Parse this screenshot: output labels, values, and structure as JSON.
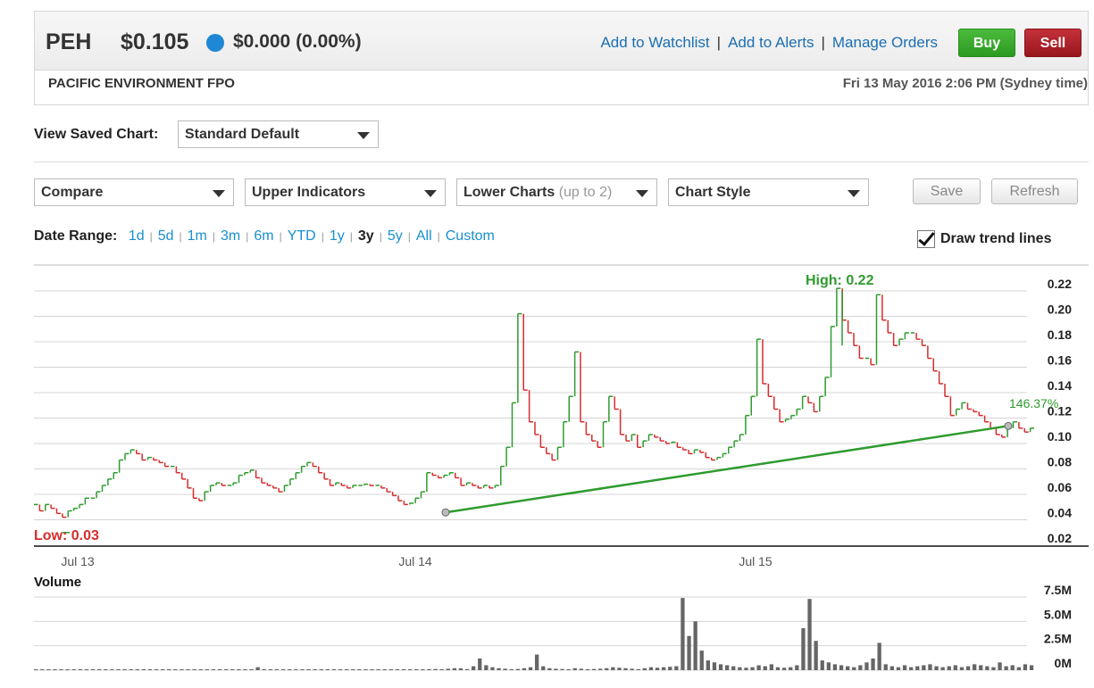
{
  "quote": {
    "ticker": "PEH",
    "price": "$0.105",
    "change": "$0.000 (0.00%)",
    "company": "PACIFIC ENVIRONMENT FPO",
    "datetime": "Fri 13 May 2016 2:06 PM (Sydney time)",
    "status_color": "#1e88d6"
  },
  "actions": {
    "watchlist": "Add to Watchlist",
    "alerts": "Add to Alerts",
    "orders": "Manage Orders",
    "buy": "Buy",
    "sell": "Sell"
  },
  "saved_chart": {
    "label": "View Saved Chart:",
    "value": "Standard Default"
  },
  "toolbar": {
    "compare": "Compare",
    "upper": "Upper Indicators",
    "lower": "Lower Charts",
    "lower_sub": "(up to 2)",
    "style": "Chart Style",
    "save": "Save",
    "refresh": "Refresh"
  },
  "date_range": {
    "label": "Date Range:",
    "options": [
      "1d",
      "5d",
      "1m",
      "3m",
      "6m",
      "YTD",
      "1y",
      "3y",
      "5y",
      "All",
      "Custom"
    ],
    "active": "3y"
  },
  "trend": {
    "label": "Draw trend lines",
    "checked": true
  },
  "chart_data": {
    "type": "line",
    "price_axis_ticks": [
      "0.22",
      "0.20",
      "0.18",
      "0.16",
      "0.14",
      "0.12",
      "0.10",
      "0.08",
      "0.06",
      "0.04",
      "0.02"
    ],
    "x_ticks": [
      "Jul 13",
      "Jul 14",
      "Jul 15"
    ],
    "high_label": "High: 0.22",
    "low_label": "Low: 0.03",
    "trendline_label": "146.37%",
    "volume_title": "Volume",
    "volume_ticks": [
      "7.5M",
      "5.0M",
      "2.5M",
      "0M"
    ],
    "ylim": [
      0.02,
      0.22
    ],
    "volume_max_millions": 7.5,
    "high": 0.22,
    "low": 0.03,
    "trendline": {
      "start": 0.043,
      "end": 0.111
    },
    "price_series": [
      [
        0.045,
        0.04,
        0.045,
        0.042
      ],
      [
        0.038,
        0.035,
        0.04,
        0.042
      ],
      [
        0.045,
        0.05,
        0.05,
        0.055
      ],
      [
        0.06,
        0.065,
        0.07,
        0.08
      ],
      [
        0.085,
        0.088,
        0.085,
        0.08
      ],
      [
        0.082,
        0.08,
        0.078,
        0.075
      ],
      [
        0.075,
        0.07,
        0.065,
        0.058
      ],
      [
        0.05,
        0.048,
        0.055,
        0.06
      ],
      [
        0.062,
        0.06,
        0.06,
        0.062
      ],
      [
        0.068,
        0.07,
        0.072,
        0.066
      ],
      [
        0.062,
        0.06,
        0.058,
        0.055
      ],
      [
        0.06,
        0.065,
        0.07,
        0.075
      ],
      [
        0.078,
        0.075,
        0.07,
        0.065
      ],
      [
        0.06,
        0.062,
        0.06,
        0.058
      ],
      [
        0.06,
        0.06,
        0.061,
        0.06
      ],
      [
        0.06,
        0.058,
        0.055,
        0.052
      ],
      [
        0.048,
        0.045,
        0.046,
        0.05
      ],
      [
        0.055,
        0.07,
        0.068,
        0.066
      ],
      [
        0.068,
        0.07,
        0.066,
        0.06
      ],
      [
        0.062,
        0.06,
        0.058,
        0.06
      ],
      [
        0.058,
        0.06,
        0.075,
        0.09
      ],
      [
        0.125,
        0.195,
        0.135,
        0.11
      ],
      [
        0.1,
        0.09,
        0.085,
        0.08
      ],
      [
        0.09,
        0.11,
        0.13,
        0.165
      ],
      [
        0.11,
        0.1,
        0.095,
        0.09
      ],
      [
        0.11,
        0.13,
        0.12,
        0.1
      ],
      [
        0.095,
        0.1,
        0.09,
        0.095
      ],
      [
        0.1,
        0.098,
        0.095,
        0.093
      ],
      [
        0.094,
        0.09,
        0.088,
        0.085
      ],
      [
        0.088,
        0.086,
        0.082,
        0.08
      ],
      [
        0.082,
        0.085,
        0.09,
        0.095
      ],
      [
        0.1,
        0.115,
        0.13,
        0.175
      ],
      [
        0.14,
        0.13,
        0.12,
        0.11
      ],
      [
        0.112,
        0.115,
        0.12,
        0.13
      ],
      [
        0.125,
        0.118,
        0.13,
        0.145
      ],
      [
        0.185,
        0.215,
        0.19,
        0.18
      ],
      [
        0.17,
        0.16,
        0.16,
        0.155
      ],
      [
        0.21,
        0.19,
        0.18,
        0.17
      ],
      [
        0.175,
        0.18,
        0.18,
        0.175
      ],
      [
        0.17,
        0.16,
        0.15,
        0.14
      ],
      [
        0.13,
        0.115,
        0.12,
        0.125
      ],
      [
        0.12,
        0.118,
        0.115,
        0.11
      ],
      [
        0.105,
        0.1,
        0.098,
        0.105
      ],
      [
        0.11,
        0.105,
        0.102,
        0.105
      ]
    ],
    "volume_series": [
      0.05,
      0.03,
      0.06,
      0.04,
      0.05,
      0.07,
      0.04,
      0.03,
      0.05,
      0.06,
      0.08,
      0.04,
      0.05,
      0.06,
      0.05,
      0.04,
      0.05,
      0.06,
      0.1,
      0.05,
      0.04,
      0.06,
      0.05,
      0.07,
      0.05,
      0.04,
      0.05,
      0.06,
      0.05,
      0.04,
      0.03,
      0.05,
      0.06,
      0.05,
      0.07,
      0.3,
      0.05,
      0.04,
      0.06,
      0.05,
      0.04,
      0.05,
      0.06,
      0.05,
      0.04,
      0.05,
      0.06,
      0.05,
      0.04,
      0.05,
      0.06,
      0.05,
      0.04,
      0.05,
      0.05,
      0.04,
      0.05,
      0.06,
      0.05,
      0.04,
      0.05,
      0.06,
      0.1,
      0.12,
      0.1,
      0.15,
      0.2,
      0.18,
      0.1,
      0.4,
      1.2,
      0.5,
      0.3,
      0.2,
      0.15,
      0.1,
      0.12,
      0.2,
      0.3,
      1.6,
      0.4,
      0.2,
      0.15,
      0.12,
      0.1,
      0.2,
      0.15,
      0.1,
      0.12,
      0.15,
      0.2,
      0.3,
      0.25,
      0.2,
      0.15,
      0.1,
      0.2,
      0.3,
      0.25,
      0.3,
      0.35,
      0.4,
      7.4,
      3.5,
      5.0,
      2.0,
      1.0,
      0.8,
      0.6,
      0.5,
      0.4,
      0.3,
      0.25,
      0.3,
      0.5,
      0.4,
      0.6,
      0.3,
      0.25,
      0.3,
      0.5,
      4.3,
      7.3,
      3.0,
      1.0,
      0.8,
      0.6,
      0.5,
      0.4,
      0.3,
      0.5,
      0.8,
      1.2,
      2.8,
      0.6,
      0.4,
      0.3,
      0.5,
      0.3,
      0.4,
      0.5,
      0.6,
      0.4,
      0.3,
      0.4,
      0.5,
      0.3,
      0.4,
      0.6,
      0.5,
      0.4,
      0.3,
      0.8,
      0.4,
      0.5,
      0.3,
      0.6,
      0.5
    ]
  }
}
